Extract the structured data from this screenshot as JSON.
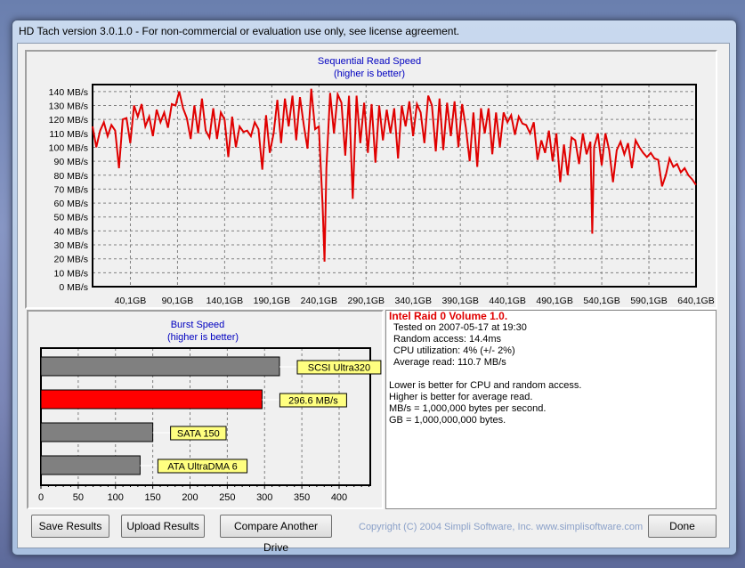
{
  "window": {
    "title": "HD Tach version 3.0.1.0  - For non-commercial or evaluation use only, see license agreement."
  },
  "chart_data": [
    {
      "type": "line",
      "title": "Sequential Read Speed",
      "subtitle": "(higher is better)",
      "xlabel": "",
      "ylabel": "",
      "xlim": [
        0,
        640.1
      ],
      "ylim": [
        0,
        145
      ],
      "grid": true,
      "color": "#e00000",
      "x_ticks": [
        "40,1GB",
        "90,1GB",
        "140,1GB",
        "190,1GB",
        "240,1GB",
        "290,1GB",
        "340,1GB",
        "390,1GB",
        "440,1GB",
        "490,1GB",
        "540,1GB",
        "590,1GB",
        "640,1GB"
      ],
      "x_tick_values": [
        40.1,
        90.1,
        140.1,
        190.1,
        240.1,
        290.1,
        340.1,
        390.1,
        440.1,
        490.1,
        540.1,
        590.1,
        640.1
      ],
      "y_ticks": [
        "0 MB/s",
        "10 MB/s",
        "20 MB/s",
        "30 MB/s",
        "40 MB/s",
        "50 MB/s",
        "60 MB/s",
        "70 MB/s",
        "80 MB/s",
        "90 MB/s",
        "100 MB/s",
        "110 MB/s",
        "120 MB/s",
        "130 MB/s",
        "140 MB/s"
      ],
      "y_tick_values": [
        0,
        10,
        20,
        30,
        40,
        50,
        60,
        70,
        80,
        90,
        100,
        110,
        120,
        130,
        140
      ],
      "x": [
        0,
        4,
        8,
        12,
        16,
        20,
        24,
        28,
        32,
        36,
        40,
        44,
        48,
        52,
        56,
        60,
        64,
        68,
        72,
        76,
        80,
        84,
        88,
        92,
        96,
        100,
        104,
        108,
        112,
        116,
        120,
        124,
        128,
        132,
        136,
        140,
        144,
        148,
        152,
        156,
        160,
        164,
        168,
        172,
        176,
        180,
        184,
        188,
        192,
        196,
        200,
        204,
        208,
        212,
        216,
        220,
        224,
        228,
        232,
        236,
        240,
        244,
        246,
        248,
        252,
        256,
        260,
        264,
        268,
        272,
        276,
        280,
        284,
        288,
        292,
        296,
        300,
        304,
        308,
        312,
        316,
        320,
        324,
        328,
        332,
        336,
        340,
        344,
        348,
        352,
        356,
        360,
        364,
        368,
        372,
        376,
        380,
        384,
        388,
        392,
        396,
        400,
        404,
        408,
        412,
        416,
        420,
        424,
        428,
        432,
        436,
        440,
        444,
        448,
        452,
        456,
        460,
        464,
        468,
        472,
        476,
        480,
        484,
        488,
        492,
        496,
        500,
        504,
        508,
        512,
        516,
        520,
        524,
        528,
        530,
        532,
        536,
        540,
        544,
        548,
        552,
        556,
        560,
        564,
        568,
        572,
        576,
        580,
        584,
        588,
        592,
        596,
        600,
        604,
        608,
        612,
        616,
        620,
        624,
        628,
        632,
        636,
        640
      ],
      "y": [
        115,
        100,
        112,
        118,
        108,
        116,
        112,
        85,
        120,
        121,
        103,
        130,
        122,
        131,
        115,
        122,
        108,
        127,
        118,
        125,
        114,
        131,
        130,
        140,
        128,
        121,
        106,
        130,
        110,
        135,
        112,
        107,
        128,
        106,
        125,
        120,
        93,
        122,
        100,
        115,
        111,
        112,
        108,
        118,
        113,
        84,
        123,
        96,
        110,
        134,
        103,
        135,
        115,
        137,
        105,
        136,
        116,
        99,
        142,
        113,
        115,
        59,
        18,
        85,
        139,
        110,
        138,
        132,
        94,
        137,
        63,
        137,
        103,
        132,
        96,
        131,
        89,
        130,
        105,
        127,
        110,
        128,
        92,
        130,
        115,
        133,
        108,
        131,
        125,
        103,
        137,
        130,
        97,
        135,
        98,
        132,
        108,
        133,
        100,
        131,
        114,
        90,
        125,
        86,
        128,
        110,
        128,
        95,
        125,
        100,
        125,
        118,
        123,
        109,
        122,
        117,
        116,
        110,
        118,
        91,
        105,
        96,
        112,
        90,
        110,
        75,
        102,
        80,
        107,
        105,
        88,
        110,
        95,
        104,
        38,
        100,
        110,
        87,
        110,
        98,
        75,
        98,
        104,
        95,
        103,
        85,
        105,
        100,
        96,
        93,
        96,
        92,
        91,
        72,
        80,
        92,
        86,
        88,
        82,
        85,
        80,
        77,
        73
      ]
    },
    {
      "type": "bar",
      "orientation": "horizontal",
      "title": "Burst Speed",
      "subtitle": "(higher is better)",
      "xlim": [
        0,
        440
      ],
      "grid": true,
      "x_ticks": [
        "0",
        "50",
        "100",
        "150",
        "200",
        "250",
        "300",
        "350",
        "400"
      ],
      "x_tick_values": [
        0,
        50,
        100,
        150,
        200,
        250,
        300,
        350,
        400
      ],
      "bars": [
        {
          "label": "SCSI Ultra320",
          "value": 320,
          "color": "#808080"
        },
        {
          "label": "296.6 MB/s",
          "value": 296.6,
          "color": "#ff0000"
        },
        {
          "label": "SATA 150",
          "value": 150,
          "color": "#808080"
        },
        {
          "label": "ATA UltraDMA 6",
          "value": 133,
          "color": "#808080"
        }
      ],
      "label_color": "#ffff80"
    }
  ],
  "info": {
    "heading": "Intel Raid 0 Volume 1.0.",
    "tested": "Tested on 2007-05-17 at 19:30",
    "random_access": "Random access: 14.4ms",
    "cpu": "CPU utilization: 4% (+/- 2%)",
    "avg_read": "Average read: 110.7 MB/s",
    "notes": [
      "Lower is better for CPU and random access.",
      "Higher is better for average read.",
      "MB/s = 1,000,000 bytes per second.",
      "GB = 1,000,000,000 bytes."
    ]
  },
  "buttons": {
    "save": "Save Results",
    "upload": "Upload Results",
    "compare": "Compare Another Drive",
    "done": "Done"
  },
  "copyright": "Copyright (C) 2004 Simpli Software, Inc. www.simplisoftware.com"
}
